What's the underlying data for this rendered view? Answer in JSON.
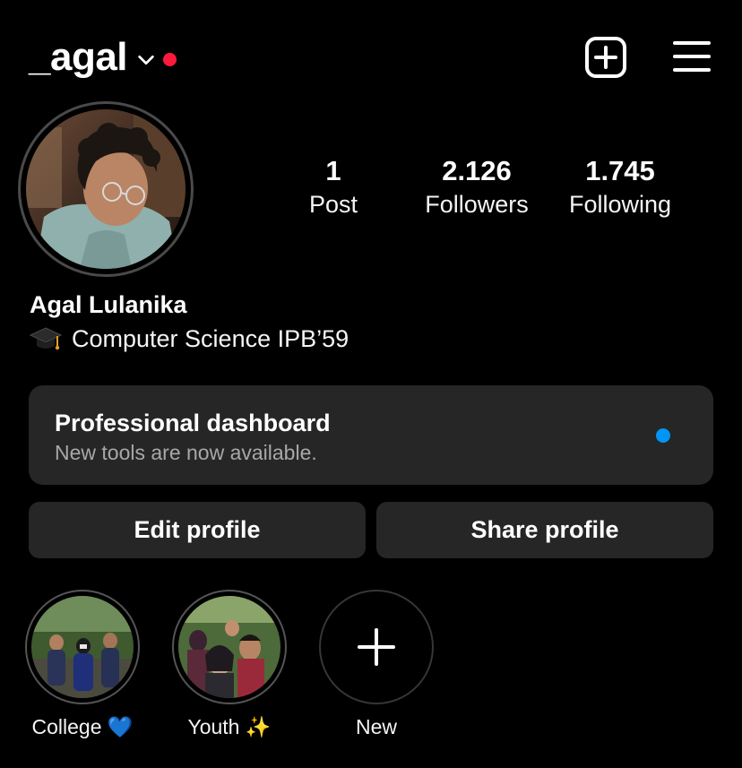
{
  "header": {
    "username": "_agal",
    "has_notification_dot": true,
    "notification_color": "#ff1a3d",
    "icons": [
      "chevron-down-icon",
      "create-post-icon",
      "hamburger-menu-icon"
    ]
  },
  "profile": {
    "stats": [
      {
        "count": "1",
        "label": "Post"
      },
      {
        "count": "2.126",
        "label": "Followers"
      },
      {
        "count": "1.745",
        "label": "Following"
      }
    ],
    "name": "Agal Lulanika",
    "bio": {
      "emoji_icon": "graduation-cap-icon",
      "text": "Computer Science IPB’59"
    }
  },
  "pro_dashboard": {
    "title": "Professional dashboard",
    "subtitle": "New tools are now available.",
    "indicator_color": "#0095f6"
  },
  "actions": {
    "edit_label": "Edit profile",
    "share_label": "Share profile"
  },
  "highlights": [
    {
      "label": "College 💙"
    },
    {
      "label": "Youth ✨"
    },
    {
      "label": "New",
      "icon": "plus-icon"
    }
  ],
  "colors": {
    "background": "#000000",
    "card": "#262626",
    "accent_blue": "#0095f6",
    "muted_text": "#a8a8a8"
  }
}
